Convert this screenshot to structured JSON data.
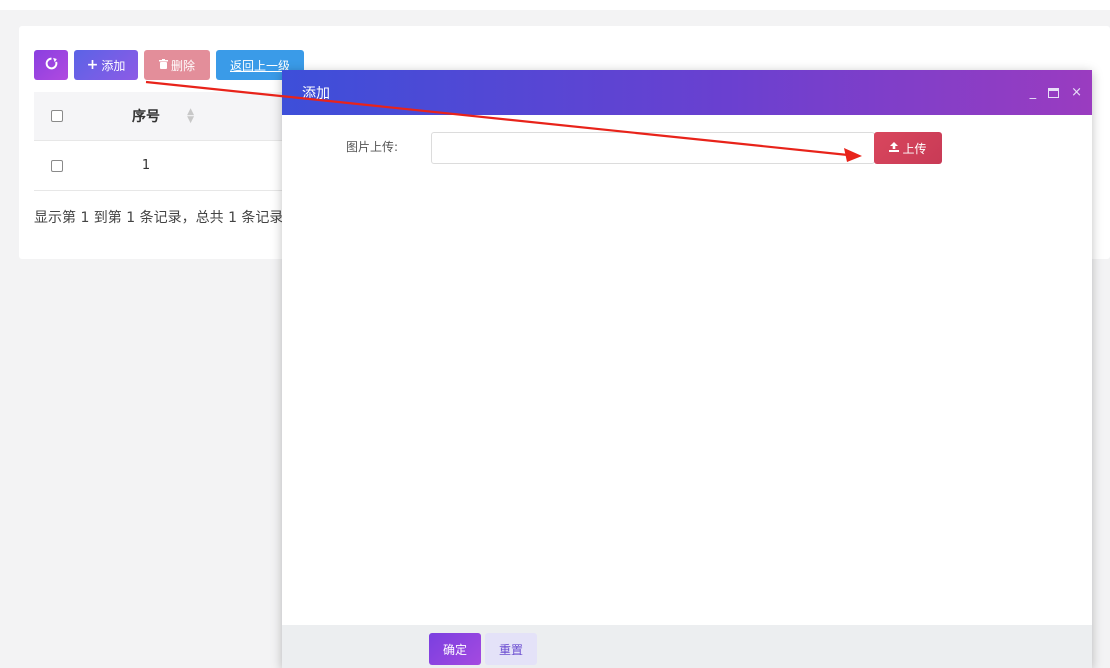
{
  "toolbar": {
    "refresh_icon": "refresh-icon",
    "add_label": "添加",
    "add_icon": "plus-icon",
    "delete_label": "删除",
    "delete_icon": "trash-icon",
    "back_label": "返回上一级"
  },
  "table": {
    "columns": [
      "序号"
    ],
    "rows": [
      {
        "index": "1"
      }
    ]
  },
  "records_text": "显示第 1 到第 1 条记录，总共 1 条记录",
  "modal": {
    "title": "添加",
    "controls": {
      "minimize": "_",
      "close": "×"
    },
    "form": {
      "image_upload_label": "图片上传:",
      "image_upload_value": "",
      "upload_button": "上传",
      "upload_icon": "upload-icon"
    },
    "footer": {
      "confirm": "确定",
      "reset": "重置"
    }
  },
  "colors": {
    "title_bar_start": "#3d4fd9",
    "title_bar_end": "#9a3cc0",
    "upload_button": "#d9475d",
    "annotation_arrow": "#e8231a"
  }
}
